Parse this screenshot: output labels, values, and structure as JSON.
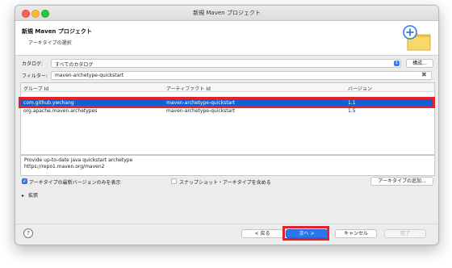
{
  "window": {
    "title": "新規 Maven プロジェクト"
  },
  "header": {
    "title": "新規 Maven プロジェクト",
    "subtitle": "アーキタイプの選択",
    "icon": "new-folder-icon"
  },
  "catalog": {
    "label": "カタログ:",
    "value": "すべてのカタログ",
    "configure_button": "構成..."
  },
  "filter": {
    "label": "フィルター:",
    "value": "maven-archetype-quickstart"
  },
  "table": {
    "columns": [
      "グループ Id",
      "アーティファクト Id",
      "バージョン"
    ],
    "rows": [
      {
        "group": "com.github.ywchang",
        "artifact": "maven-archetype-quickstart",
        "version": "1.1",
        "selected": true
      },
      {
        "group": "org.apache.maven.archetypes",
        "artifact": "maven-archetype-quickstart",
        "version": "1.5",
        "selected": false
      }
    ]
  },
  "description": {
    "line1": "Provide up-to-date java quickstart archetype",
    "line2": "https://repo1.maven.org/maven2"
  },
  "options": {
    "latest_only": "アーキタイプの最新バージョンのみを表示",
    "latest_only_checked": true,
    "snapshots": "スナップショット・アーキタイプを含める",
    "snapshots_checked": false,
    "add_archetype_button": "アーキタイプの追加..."
  },
  "advanced": {
    "label": "拡張"
  },
  "footer": {
    "back": "< 戻る",
    "next": "次へ >",
    "cancel": "キャンセル",
    "finish": "完了"
  },
  "colors": {
    "selection": "#1060d8",
    "highlight_box": "#e8202a",
    "primary_button": "#2a76f0"
  }
}
